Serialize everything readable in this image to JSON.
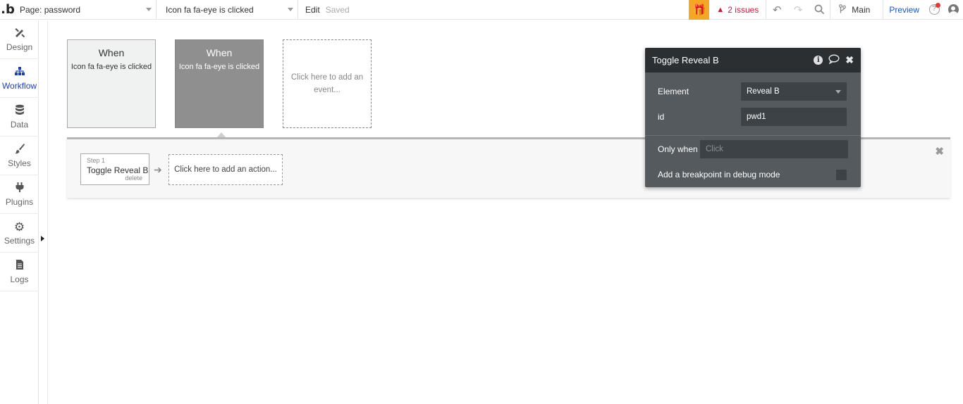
{
  "topbar": {
    "logo": ".b",
    "page_select": "Page: password",
    "event_select": "Icon fa fa-eye is clicked",
    "edit_label": "Edit",
    "saved_label": "Saved",
    "issues_label": "2 issues",
    "branch_label": "Main",
    "preview_label": "Preview",
    "icons": [
      "gift-icon",
      "warning-icon",
      "undo-icon",
      "redo-icon",
      "search-icon",
      "branch-icon",
      "help-icon",
      "user-icon"
    ],
    "colors": {
      "gift_bg": "#f5a623",
      "issues": "#d0183c",
      "preview": "#1a56c9"
    }
  },
  "sidebar": {
    "items": [
      {
        "label": "Design",
        "icon": "design-icon",
        "active": false
      },
      {
        "label": "Workflow",
        "icon": "workflow-icon",
        "active": true
      },
      {
        "label": "Data",
        "icon": "database-icon",
        "active": false
      },
      {
        "label": "Styles",
        "icon": "brush-icon",
        "active": false
      },
      {
        "label": "Plugins",
        "icon": "plug-icon",
        "active": false
      },
      {
        "label": "Settings",
        "icon": "gear-icon",
        "active": false
      },
      {
        "label": "Logs",
        "icon": "document-icon",
        "active": false
      }
    ],
    "active_color": "#1a3fbd"
  },
  "events": [
    {
      "when": "When",
      "event": "Icon fa fa-eye is clicked",
      "selected": false
    },
    {
      "when": "When",
      "event": "Icon fa fa-eye is clicked",
      "selected": true
    }
  ],
  "add_event_label": "Click here to add an event...",
  "actions": {
    "step_label": "Step 1",
    "step_name": "Toggle Reveal B",
    "delete_label": "delete",
    "add_action_label": "Click here to add an action..."
  },
  "panel": {
    "title": "Toggle Reveal B",
    "element_label": "Element",
    "element_value": "Reveal B",
    "id_label": "id",
    "id_value": "pwd1",
    "only_when_label": "Only when",
    "only_when_placeholder": "Click",
    "breakpoint_label": "Add a breakpoint in debug mode",
    "breakpoint_checked": false
  }
}
